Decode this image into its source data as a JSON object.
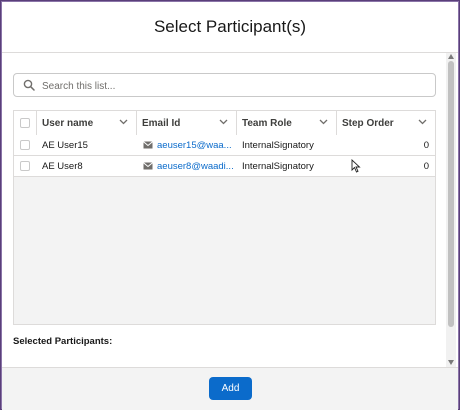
{
  "modal": {
    "title": "Select Participant(s)"
  },
  "search": {
    "placeholder": "Search this list..."
  },
  "table": {
    "headers": {
      "user_name": "User name",
      "email_id": "Email Id",
      "team_role": "Team Role",
      "step_order": "Step Order"
    },
    "rows": [
      {
        "user_name": "AE User15",
        "email": "aeuser15@waa...",
        "team_role": "InternalSignatory",
        "step_order": "0"
      },
      {
        "user_name": "AE User8",
        "email": "aeuser8@waadi...",
        "team_role": "InternalSignatory",
        "step_order": "0"
      }
    ]
  },
  "selected": {
    "label": "Selected Participants:"
  },
  "footer": {
    "add_label": "Add"
  },
  "colors": {
    "accent": "#0b6bcb",
    "frame": "#5a3f7a"
  },
  "icons": {
    "search": "search-icon",
    "mail": "mail-icon",
    "chevron": "chevron-down-icon"
  }
}
